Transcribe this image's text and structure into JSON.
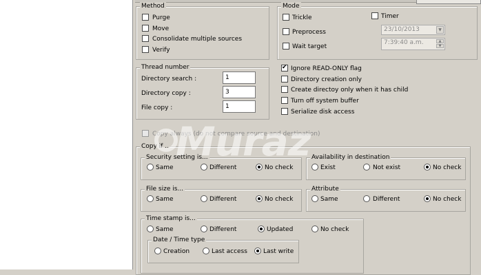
{
  "method": {
    "title": "Method",
    "items": [
      {
        "label": "Purge",
        "checked": false
      },
      {
        "label": "Move",
        "checked": false
      },
      {
        "label": "Consolidate multiple sources",
        "checked": false
      },
      {
        "label": "Verify",
        "checked": false
      }
    ]
  },
  "mode": {
    "title": "Mode",
    "trickle": "Trickle",
    "timer": "Timer",
    "preprocess": "Preprocess",
    "wait_target": "Wait target",
    "date_value": "23/10/2013",
    "time_value": "7:39:40 a.m."
  },
  "thread": {
    "title": "Thread number",
    "directory_search_label": "Directory search :",
    "directory_search_value": "1",
    "directory_copy_label": "Directory copy :",
    "directory_copy_value": "3",
    "file_copy_label": "File copy :",
    "file_copy_value": "1"
  },
  "flags": [
    {
      "label": "Ignore READ-ONLY flag",
      "checked": true
    },
    {
      "label": "Directory creation only",
      "checked": false
    },
    {
      "label": "Create directoy only when it has child",
      "checked": false
    },
    {
      "label": "Turn off system buffer",
      "checked": false
    },
    {
      "label": "Serialize disk access",
      "checked": false
    }
  ],
  "copy_always": "Copy always (do not compare source and destination)",
  "copy_if": {
    "title": "Copy if ..",
    "security": {
      "title": "Security setting is...",
      "opt1": "Same",
      "opt2": "Different",
      "opt3": "No check",
      "selected": "No check"
    },
    "availability": {
      "title": "Availability in destination",
      "opt1": "Exist",
      "opt2": "Not exist",
      "opt3": "No check",
      "selected": "No check"
    },
    "filesize": {
      "title": "File size is...",
      "opt1": "Same",
      "opt2": "Different",
      "opt3": "No check",
      "selected": "No check"
    },
    "attribute": {
      "title": "Attribute",
      "opt1": "Same",
      "opt2": "Different",
      "opt3": "No check",
      "selected": "No check"
    },
    "timestamp": {
      "title": "Time stamp is...",
      "opt1": "Same",
      "opt2": "Different",
      "opt3": "Updated",
      "opt4": "No check",
      "selected": "Updated"
    },
    "datetime": {
      "title": "Date / Time type",
      "opt1": "Creation",
      "opt2": "Last access",
      "opt3": "Last write",
      "selected": "Last write"
    }
  },
  "watermark": "Muraz"
}
